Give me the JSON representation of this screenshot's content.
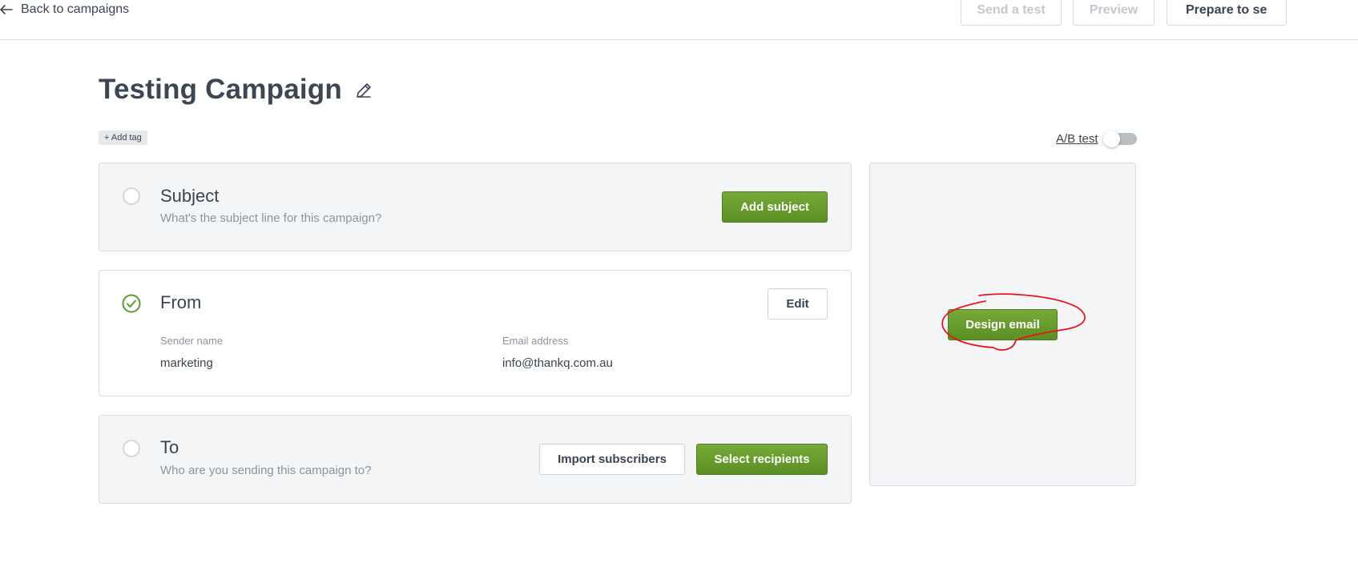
{
  "header": {
    "back_label": "Back to campaigns",
    "send_test_label": "Send a test",
    "preview_label": "Preview",
    "prepare_label": "Prepare to se"
  },
  "campaign": {
    "title": "Testing Campaign",
    "add_tag_label": "+ Add tag",
    "ab_test_label": "A/B test",
    "ab_test_enabled": false
  },
  "subject": {
    "title": "Subject",
    "description": "What's the subject line for this campaign?",
    "button_label": "Add subject"
  },
  "from": {
    "title": "From",
    "edit_label": "Edit",
    "sender_name_label": "Sender name",
    "sender_name_value": "marketing",
    "email_label": "Email address",
    "email_value": "info@thankq.com.au"
  },
  "to": {
    "title": "To",
    "description": "Who are you sending this campaign to?",
    "import_label": "Import subscribers",
    "select_label": "Select recipients"
  },
  "design": {
    "button_label": "Design email"
  },
  "colors": {
    "green_accent": "#6a9e2f",
    "annotation_red": "#e8141c"
  }
}
